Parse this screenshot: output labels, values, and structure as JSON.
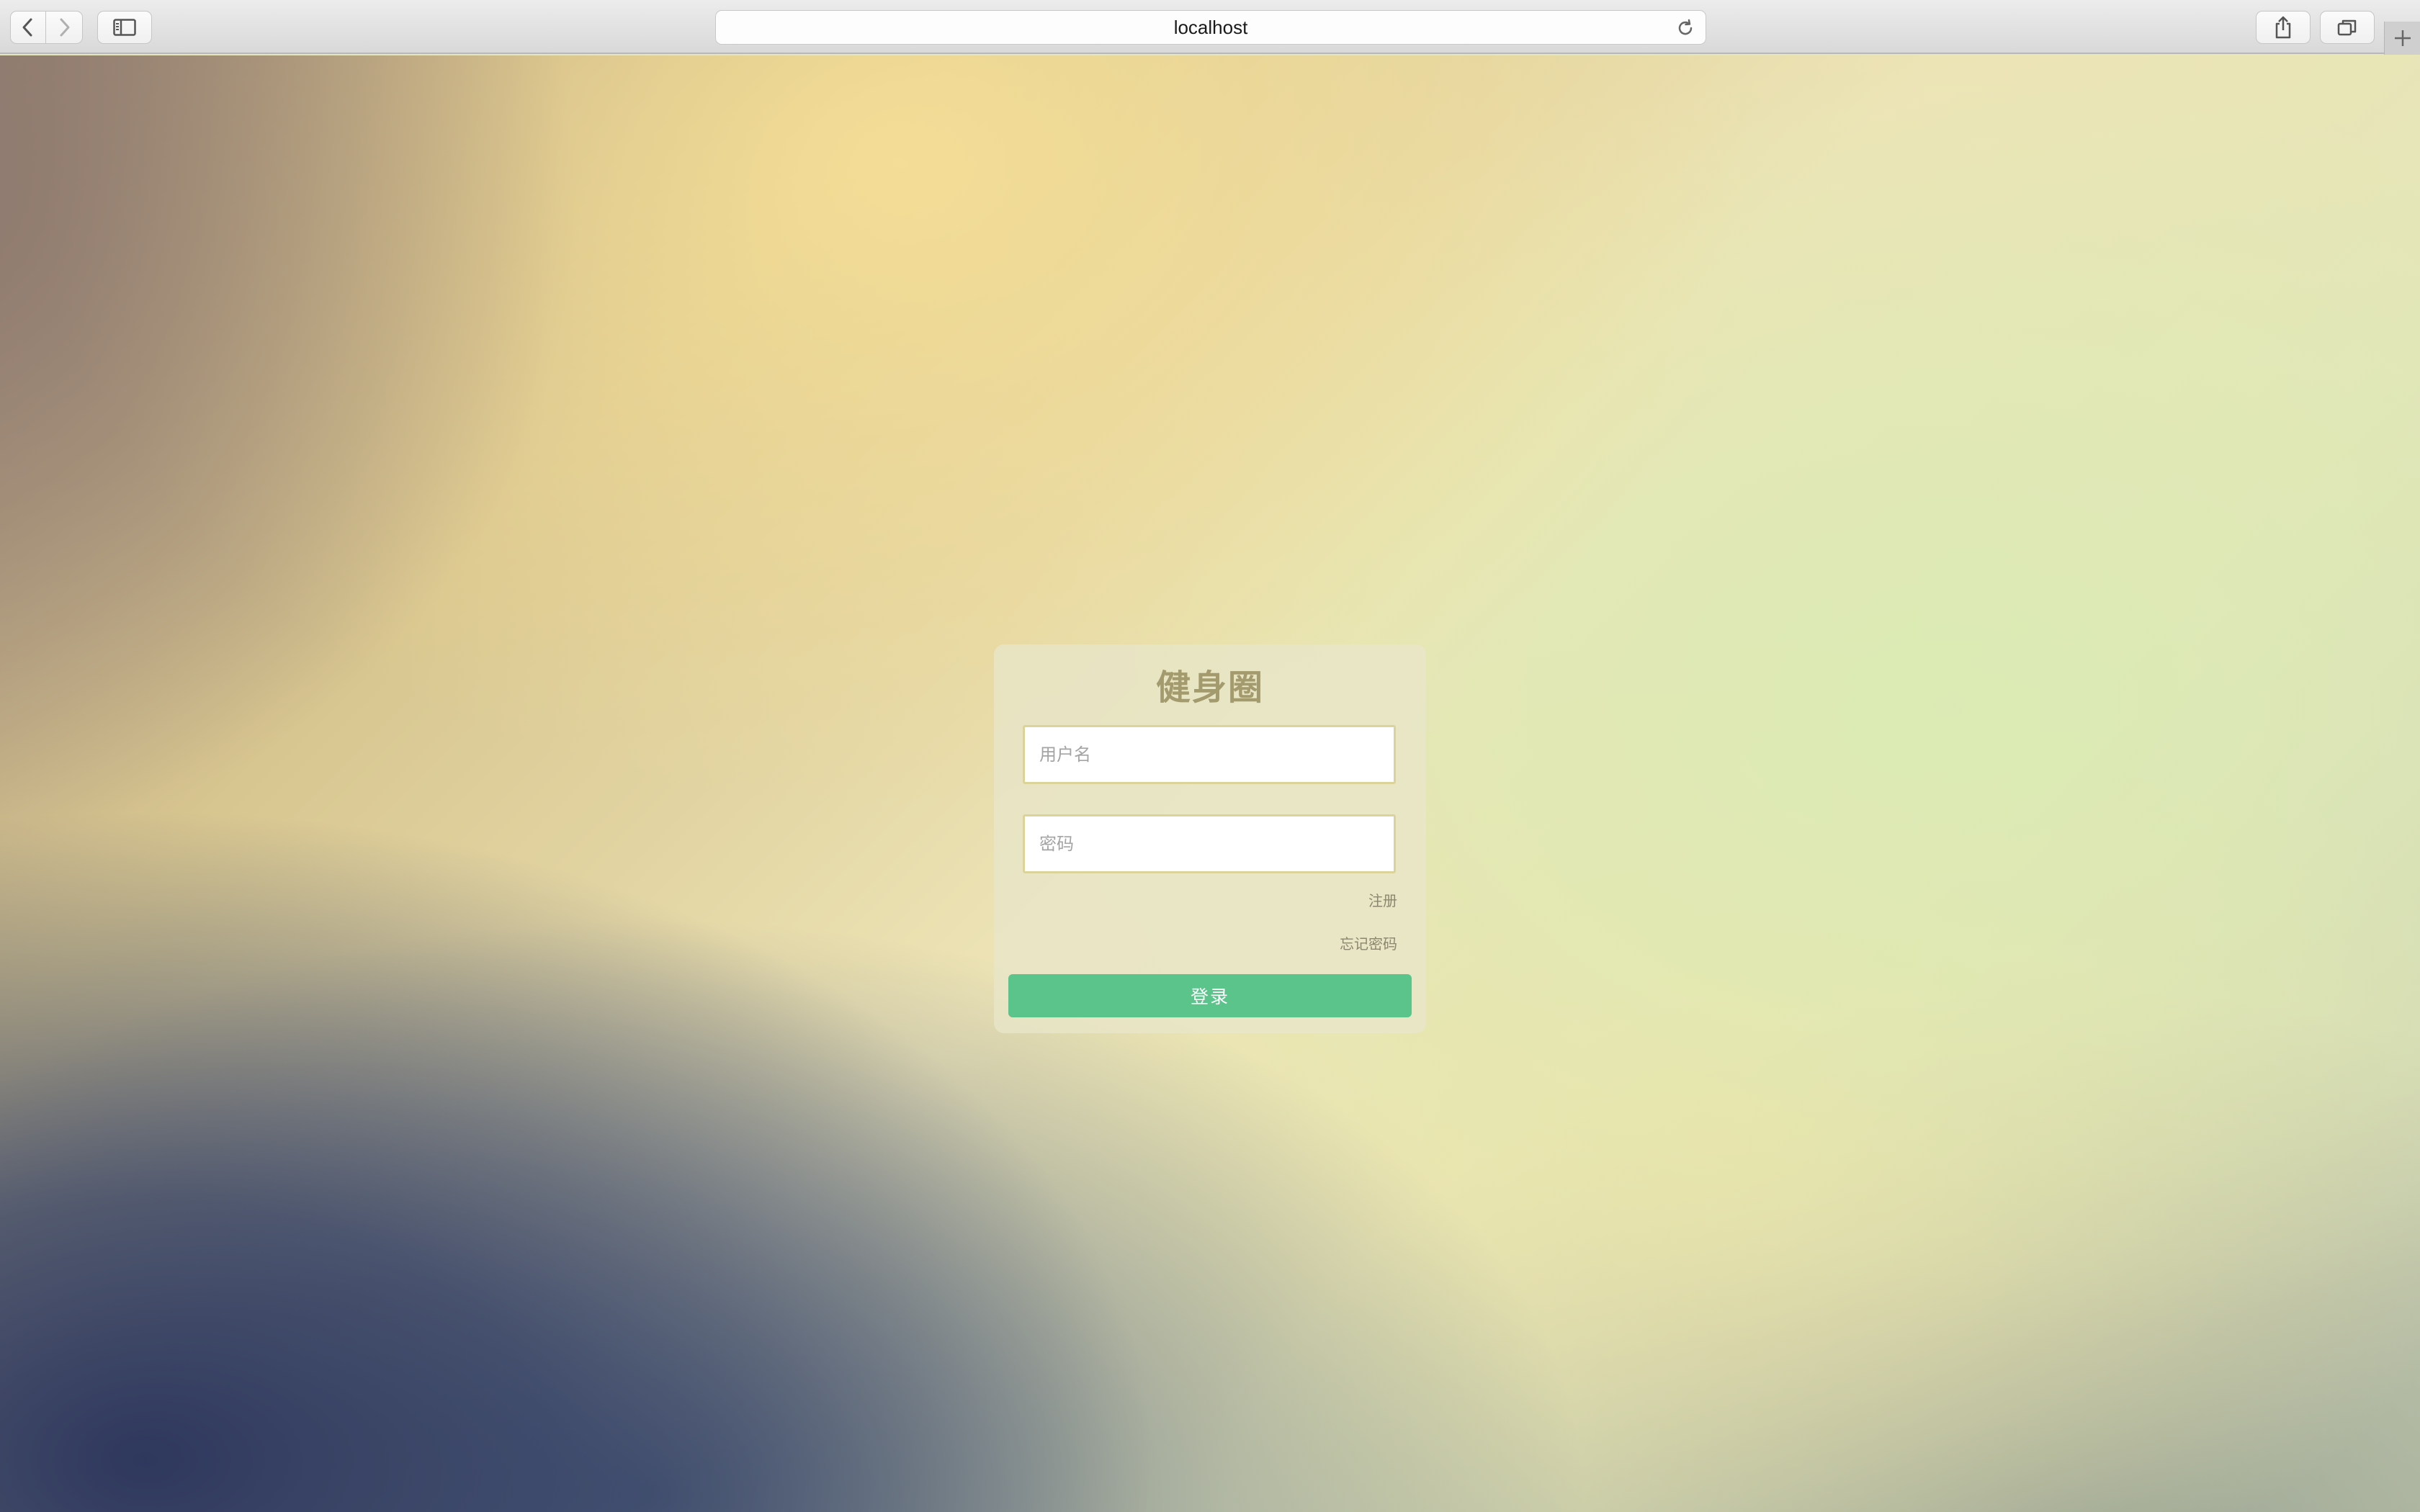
{
  "browser": {
    "url": "localhost",
    "icons": {
      "back": "chevron-left-icon",
      "forward": "chevron-right-icon",
      "sidebar": "sidebar-icon",
      "reload": "reload-icon",
      "share": "share-icon",
      "tabs": "tabs-overview-icon",
      "new_tab": "plus-icon"
    }
  },
  "login": {
    "title": "健身圈",
    "username_placeholder": "用户名",
    "username_value": "",
    "password_placeholder": "密码",
    "password_value": "",
    "register_label": "注册",
    "forgot_label": "忘记密码",
    "submit_label": "登录"
  },
  "colors": {
    "accent_button": "#5ac48a",
    "title_text": "#a39a6e",
    "input_border": "#dcd39b"
  }
}
